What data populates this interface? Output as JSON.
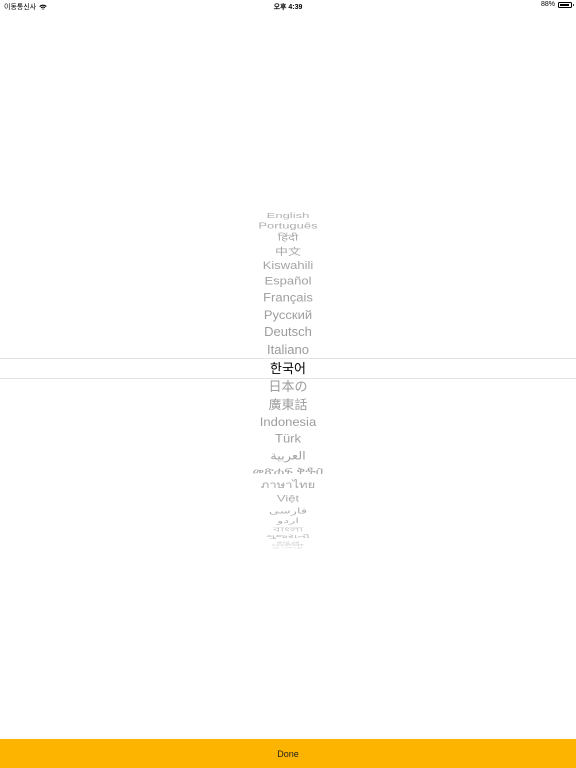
{
  "status_bar": {
    "carrier": "이동통신사",
    "time": "오후 4:39",
    "battery": "88%",
    "battery_level": 0.88
  },
  "picker": {
    "selected_index": 10,
    "items": [
      {
        "label": "English"
      },
      {
        "label": "Português"
      },
      {
        "label": "हिंदी"
      },
      {
        "label": "中文"
      },
      {
        "label": "Kiswahili"
      },
      {
        "label": "Español"
      },
      {
        "label": "Français"
      },
      {
        "label": "Русский"
      },
      {
        "label": "Deutsch"
      },
      {
        "label": "Italiano"
      },
      {
        "label": "한국어"
      },
      {
        "label": "日本の"
      },
      {
        "label": "廣東話"
      },
      {
        "label": "Indonesia"
      },
      {
        "label": "Türk"
      },
      {
        "label": "العربية"
      },
      {
        "label": "መጽሐፍ ቅዱስ"
      },
      {
        "label": "ภาษาไทย"
      },
      {
        "label": "Việt"
      },
      {
        "label": "فارسی"
      },
      {
        "label": "اردو"
      },
      {
        "label": "বাংলা"
      },
      {
        "label": "ગુજરાતી"
      },
      {
        "label": "ಕನ್ನಡ"
      },
      {
        "label": "ਪੰਜਾਬੀ"
      },
      {
        "label": "தமிழ்"
      }
    ]
  },
  "done_button": {
    "label": "Done"
  },
  "colors": {
    "accent": "#fdb400",
    "picker_text": "#9b9b9b",
    "selected_text": "#000000"
  }
}
